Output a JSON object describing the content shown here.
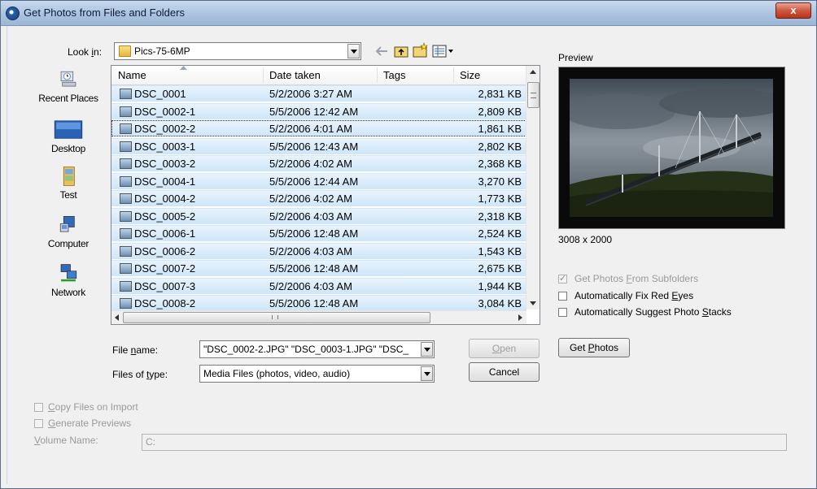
{
  "window": {
    "title": "Get Photos from Files and Folders",
    "close_glyph": "x"
  },
  "look_in": {
    "label_pre": "Look ",
    "label_key": "i",
    "label_post": "n:",
    "value": "Pics-75-6MP"
  },
  "places": [
    {
      "label": "Recent Places",
      "icon": "recent-places-icon"
    },
    {
      "label": "Desktop",
      "icon": "desktop-icon"
    },
    {
      "label": "Test",
      "icon": "folder-icon"
    },
    {
      "label": "Computer",
      "icon": "computer-icon"
    },
    {
      "label": "Network",
      "icon": "network-icon"
    }
  ],
  "columns": [
    "Name",
    "Date taken",
    "Tags",
    "Size"
  ],
  "files": [
    {
      "name": "DSC_0001",
      "date": "5/2/2006 3:27 AM",
      "tags": "",
      "size": "2,831 KB"
    },
    {
      "name": "DSC_0002-1",
      "date": "5/5/2006 12:42 AM",
      "tags": "",
      "size": "2,809 KB"
    },
    {
      "name": "DSC_0002-2",
      "date": "5/2/2006 4:01 AM",
      "tags": "",
      "size": "1,861 KB"
    },
    {
      "name": "DSC_0003-1",
      "date": "5/5/2006 12:43 AM",
      "tags": "",
      "size": "2,802 KB"
    },
    {
      "name": "DSC_0003-2",
      "date": "5/2/2006 4:02 AM",
      "tags": "",
      "size": "2,368 KB"
    },
    {
      "name": "DSC_0004-1",
      "date": "5/5/2006 12:44 AM",
      "tags": "",
      "size": "3,270 KB"
    },
    {
      "name": "DSC_0004-2",
      "date": "5/2/2006 4:02 AM",
      "tags": "",
      "size": "1,773 KB"
    },
    {
      "name": "DSC_0005-2",
      "date": "5/2/2006 4:03 AM",
      "tags": "",
      "size": "2,318 KB"
    },
    {
      "name": "DSC_0006-1",
      "date": "5/5/2006 12:48 AM",
      "tags": "",
      "size": "2,524 KB"
    },
    {
      "name": "DSC_0006-2",
      "date": "5/2/2006 4:03 AM",
      "tags": "",
      "size": "1,543 KB"
    },
    {
      "name": "DSC_0007-2",
      "date": "5/5/2006 12:48 AM",
      "tags": "",
      "size": "2,675 KB"
    },
    {
      "name": "DSC_0007-3",
      "date": "5/2/2006 4:03 AM",
      "tags": "",
      "size": "1,944 KB"
    },
    {
      "name": "DSC_0008-2",
      "date": "5/5/2006 12:48 AM",
      "tags": "",
      "size": "3,084 KB"
    }
  ],
  "file_name": {
    "label_pre": "File ",
    "label_key": "n",
    "label_post": "ame:",
    "value": "\"DSC_0002-2.JPG\" \"DSC_0003-1.JPG\" \"DSC_"
  },
  "file_type": {
    "label_pre": "Files of ",
    "label_key": "t",
    "label_post": "ype:",
    "value": "Media Files (photos, video, audio)"
  },
  "buttons": {
    "open_key": "O",
    "open_rest": "pen",
    "cancel": "Cancel",
    "get_pre": "Get ",
    "get_key": "P",
    "get_rest": "hotos"
  },
  "preview": {
    "label": "Preview",
    "dimensions": "3008 x 2000"
  },
  "options": {
    "subfolders_pre": "Get Photos ",
    "subfolders_key": "F",
    "subfolders_rest": "rom Subfolders",
    "red_eyes_pre": "Automatically Fix Red ",
    "red_eyes_key": "E",
    "red_eyes_rest": "yes",
    "stacks_pre": "Automatically Suggest Photo ",
    "stacks_key": "S",
    "stacks_rest": "tacks"
  },
  "import": {
    "copy_key": "C",
    "copy_rest": "opy Files on Import",
    "gen_key": "G",
    "gen_rest": "enerate Previews",
    "volume_key": "V",
    "volume_rest": "olume Name:",
    "volume_value": "C:"
  },
  "colors": {
    "selection": "#cde6f9",
    "title_bar": "#a9c1de",
    "close": "#d0573f"
  }
}
